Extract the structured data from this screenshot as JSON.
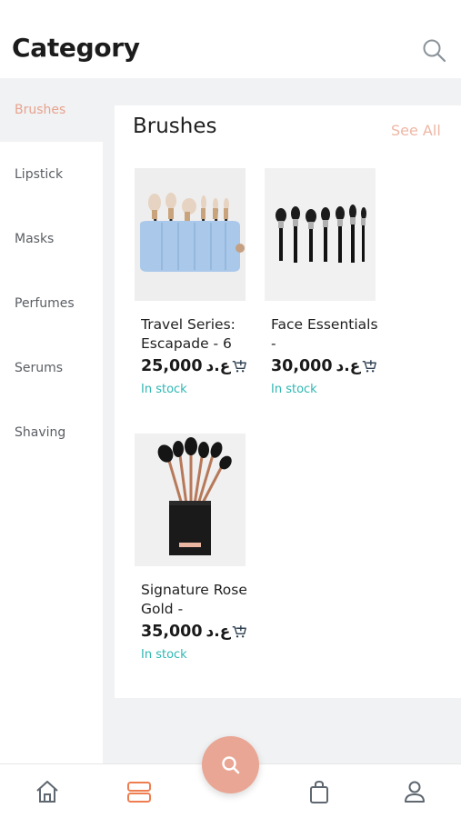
{
  "header": {
    "title": "Category"
  },
  "sidebar": {
    "items": [
      {
        "label": "Brushes",
        "active": true
      },
      {
        "label": "Lipstick",
        "active": false
      },
      {
        "label": "Masks",
        "active": false
      },
      {
        "label": "Perfumes",
        "active": false
      },
      {
        "label": "Serums",
        "active": false
      },
      {
        "label": "Shaving",
        "active": false
      }
    ]
  },
  "content": {
    "section_title": "Brushes",
    "see_all_label": "See All",
    "products": [
      {
        "name": "Travel Series: Escapade - 6",
        "price": "25,000",
        "currency": "ع.د",
        "stock": "In stock"
      },
      {
        "name": "Face Essentials -",
        "price": "30,000",
        "currency": "ع.د",
        "stock": "In stock"
      },
      {
        "name": "Signature Rose Gold -",
        "price": "35,000",
        "currency": "ع.د",
        "stock": "In stock"
      }
    ]
  },
  "bottom_nav": {
    "items": [
      "home-icon",
      "categories-icon",
      "search-icon",
      "bag-icon",
      "profile-icon"
    ],
    "active": "categories-icon"
  },
  "colors": {
    "accent": "#eaa694",
    "active_text": "#e8a38f",
    "stock": "#2fb7b4",
    "background": "#f1f2f3"
  }
}
